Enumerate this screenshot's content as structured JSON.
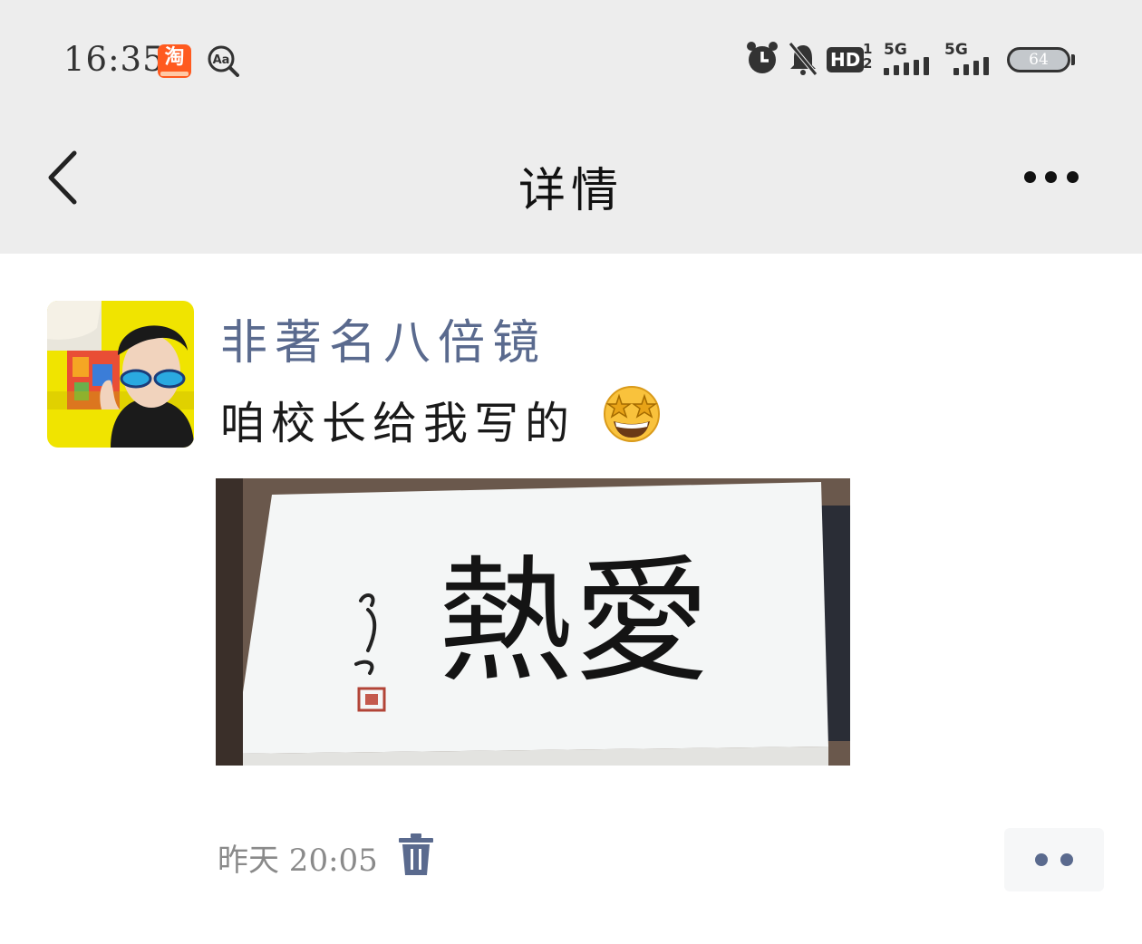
{
  "status_bar": {
    "time": "16:35",
    "left_icons": [
      "taobao-app-icon",
      "text-recognition-icon"
    ],
    "taobao_glyph": "淘",
    "aa_label": "Aa",
    "hd_label": "HD",
    "hd_fraction": [
      "1",
      "2"
    ],
    "network_1": "5G",
    "network_2": "5G",
    "battery_level": "64",
    "right_icons": [
      "alarm-icon",
      "mute-bell-icon",
      "hd-icon",
      "signal-icon",
      "signal-icon",
      "battery-icon"
    ]
  },
  "header": {
    "title": "详情",
    "back_icon": "chevron-left-icon",
    "more_icon": "more-dots-icon"
  },
  "post": {
    "author": "非著名八倍镜",
    "text": "咱校长给我写的",
    "emoji": "star-struck-emoji",
    "image_text": "熱愛",
    "time": "昨天 20:05",
    "delete_icon": "trash-icon",
    "action_icon": "comment-like-dots-icon"
  },
  "colors": {
    "header_bg": "#ededed",
    "author_name": "#5a6a8e",
    "timestamp": "#8a8a8a"
  }
}
